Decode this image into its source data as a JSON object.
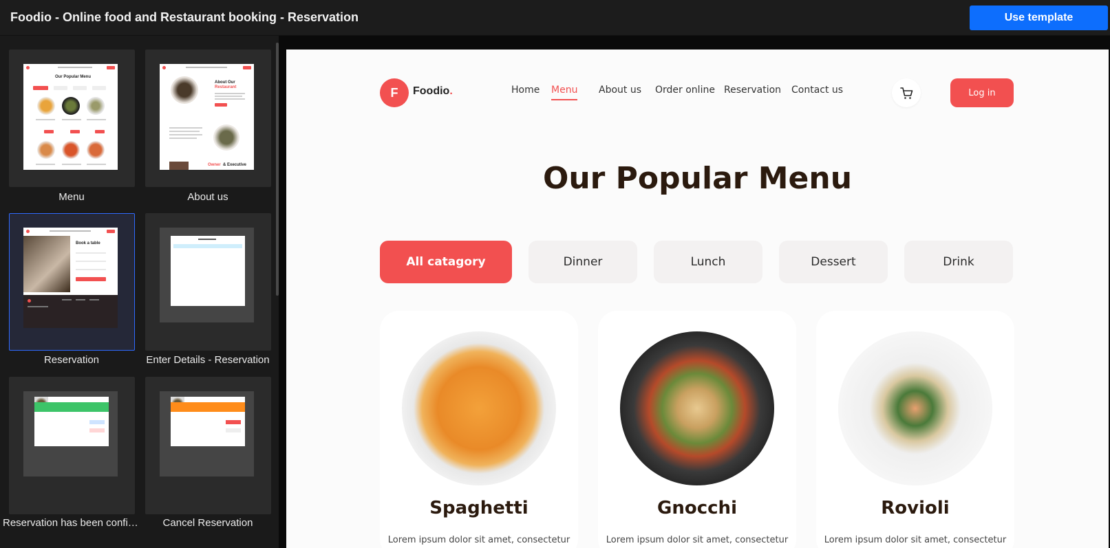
{
  "app": {
    "title": "Foodio - Online food and Restaurant booking - Reservation",
    "use_template_label": "Use template"
  },
  "sidebar": {
    "items": [
      {
        "label": "Menu",
        "selected": false
      },
      {
        "label": "About us",
        "selected": false
      },
      {
        "label": "Reservation",
        "selected": true
      },
      {
        "label": "Enter Details - Reservation",
        "selected": false
      },
      {
        "label": "Reservation has been confirmed",
        "selected": false
      },
      {
        "label": "Cancel Reservation",
        "selected": false
      }
    ],
    "thumb_texts": {
      "menu_title": "Our Popular Menu",
      "about_title": "About Our",
      "about_title_accent": "Restaurant",
      "about_footer": "Owner",
      "about_footer_accent": "& Executive",
      "reservation_title": "Book a table"
    }
  },
  "preview": {
    "logo_letter": "F",
    "logo_text": "Foodio",
    "logo_dot": ".",
    "nav": [
      {
        "label": "Home",
        "active": false
      },
      {
        "label": "Menu",
        "active": true
      },
      {
        "label": "About us",
        "active": false
      },
      {
        "label": "Order online",
        "active": false
      },
      {
        "label": "Reservation",
        "active": false
      },
      {
        "label": "Contact us",
        "active": false
      }
    ],
    "login_label": "Log in",
    "section_title": "Our Popular Menu",
    "categories": [
      {
        "label": "All catagory",
        "active": true
      },
      {
        "label": "Dinner",
        "active": false
      },
      {
        "label": "Lunch",
        "active": false
      },
      {
        "label": "Dessert",
        "active": false
      },
      {
        "label": "Drink",
        "active": false
      }
    ],
    "foods": [
      {
        "name": "Spaghetti",
        "desc": "Lorem ipsum dolor sit amet, consectetur"
      },
      {
        "name": "Gnocchi",
        "desc": "Lorem ipsum dolor sit amet, consectetur"
      },
      {
        "name": "Rovioli",
        "desc": "Lorem ipsum dolor sit amet, consectetur"
      }
    ]
  },
  "colors": {
    "brand": "#f25050",
    "primary_button": "#0d6efd",
    "heading": "#2b1a0e"
  }
}
